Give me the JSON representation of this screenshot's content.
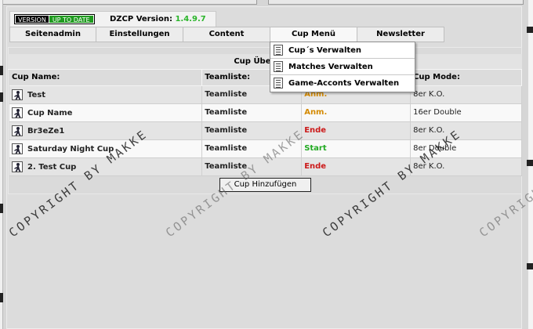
{
  "version_badge": {
    "left_text": "VERSION",
    "right_text": "UP TO DATE"
  },
  "dzcp": {
    "label": "DZCP Version:",
    "version": "1.4.9.7"
  },
  "nav": {
    "tabs": [
      "Seitenadmin",
      "Einstellungen",
      "Content",
      "Cup Menü",
      "Newsletter"
    ],
    "active": "Cup Menü"
  },
  "dropdown": {
    "items": [
      "Cup´s Verwalten",
      "Matches Verwalten",
      "Game-Acconts Verwalten"
    ]
  },
  "table": {
    "title": "Cup Übersicht",
    "headers": [
      "Cup Name:",
      "Teamliste:",
      "",
      "Cup Mode:"
    ],
    "rows": [
      {
        "name": "Test",
        "team": "Teamliste",
        "status": "Anm.",
        "mode": "8er K.O."
      },
      {
        "name": "Cup Name",
        "team": "Teamliste",
        "status": "Anm.",
        "mode": "16er Double"
      },
      {
        "name": "Br3eZe1",
        "team": "Teamliste",
        "status": "Ende",
        "mode": "8er K.O."
      },
      {
        "name": "Saturday Night Cup",
        "team": "Teamliste",
        "status": "Start",
        "mode": "8er Double"
      },
      {
        "name": "2. Test Cup",
        "team": "Teamliste",
        "status": "Ende",
        "mode": "8er K.O."
      }
    ]
  },
  "add_button": "Cup Hinzufügen",
  "watermark": "COPYRIGHT BY MAKKE",
  "colors": {
    "status_anm": "#d48a00",
    "status_ende": "#cc1a1a",
    "status_start": "#22aa22",
    "version_ok": "#1f9a1f"
  }
}
